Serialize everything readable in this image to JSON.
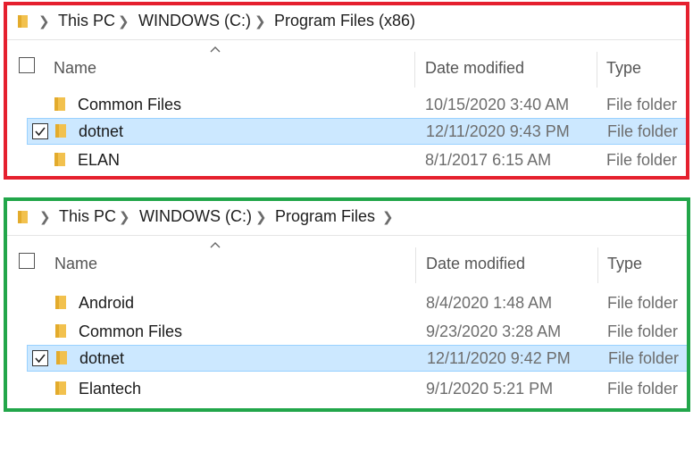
{
  "colors": {
    "highlight_red": "#e5202e",
    "highlight_green": "#22a64a",
    "selection": "#cce8ff"
  },
  "panel_red": {
    "breadcrumb": [
      "This PC",
      "WINDOWS (C:)",
      "Program Files (x86)"
    ],
    "columns": {
      "name": "Name",
      "date": "Date modified",
      "type": "Type"
    },
    "rows": [
      {
        "name": "Common Files",
        "date": "10/15/2020 3:40 AM",
        "type": "File folder",
        "selected": false
      },
      {
        "name": "dotnet",
        "date": "12/11/2020 9:43 PM",
        "type": "File folder",
        "selected": true
      },
      {
        "name": "ELAN",
        "date": "8/1/2017 6:15 AM",
        "type": "File folder",
        "selected": false
      }
    ]
  },
  "panel_green": {
    "breadcrumb": [
      "This PC",
      "WINDOWS (C:)",
      "Program Files"
    ],
    "columns": {
      "name": "Name",
      "date": "Date modified",
      "type": "Type"
    },
    "rows": [
      {
        "name": "Android",
        "date": "8/4/2020 1:48 AM",
        "type": "File folder",
        "selected": false
      },
      {
        "name": "Common Files",
        "date": "9/23/2020 3:28 AM",
        "type": "File folder",
        "selected": false
      },
      {
        "name": "dotnet",
        "date": "12/11/2020 9:42 PM",
        "type": "File folder",
        "selected": true
      },
      {
        "name": "Elantech",
        "date": "9/1/2020 5:21 PM",
        "type": "File folder",
        "selected": false
      }
    ]
  }
}
